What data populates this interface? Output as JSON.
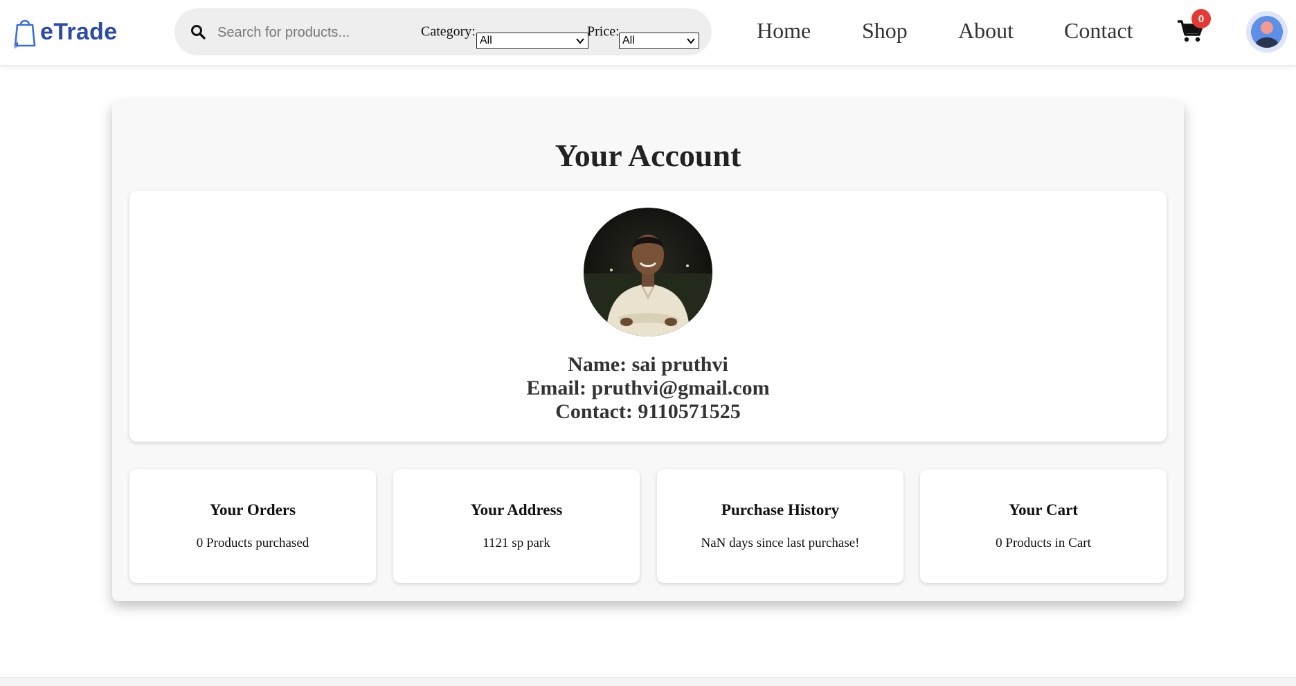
{
  "brand": {
    "name": "eTrade",
    "color": "#2c4aa8"
  },
  "search": {
    "placeholder": "Search for products...",
    "category_label": "Category:",
    "category_value": "All",
    "price_label": "Price:",
    "price_value": "All"
  },
  "nav": {
    "home": "Home",
    "shop": "Shop",
    "about": "About",
    "contact": "Contact"
  },
  "cart": {
    "count": "0",
    "badge_color": "#e53935"
  },
  "icons": {
    "search": "search-icon",
    "cart": "cart-icon",
    "user": "user-avatar-icon",
    "logo": "shopping-bag-icon"
  },
  "account": {
    "title": "Your Account",
    "name_line": "Name: sai pruthvi",
    "email_line": "Email: pruthvi@gmail.com",
    "contact_line": "Contact: 9110571525"
  },
  "stats": [
    {
      "title": "Your Orders",
      "value": "0 Products purchased"
    },
    {
      "title": "Your Address",
      "value": "1121 sp park"
    },
    {
      "title": "Purchase History",
      "value": "NaN days since last purchase!"
    },
    {
      "title": "Your Cart",
      "value": "0 Products in Cart"
    }
  ]
}
